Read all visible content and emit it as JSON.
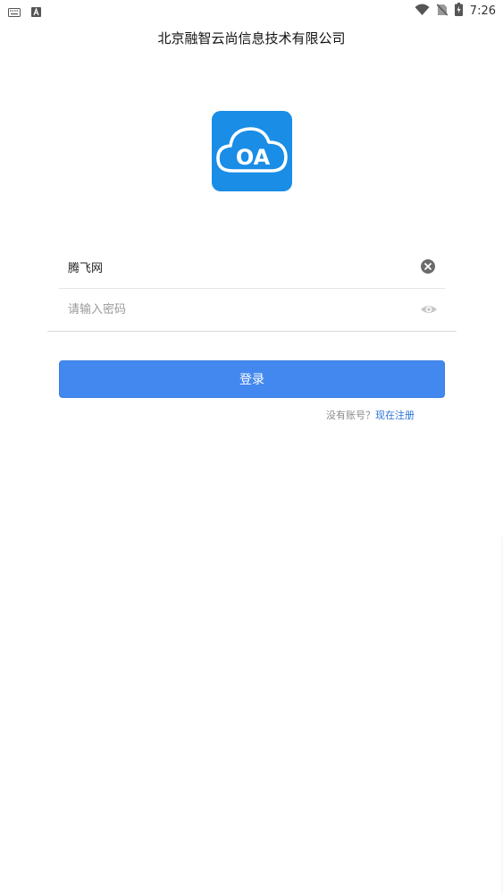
{
  "status_bar": {
    "time": "7:26",
    "left_icons": [
      "keyboard-icon",
      "text-a-icon"
    ],
    "right_icons": [
      "wifi-icon",
      "no-sim-icon",
      "battery-charging-icon"
    ]
  },
  "header": {
    "title": "北京融智云尚信息技术有限公司"
  },
  "logo": {
    "text": "OA",
    "icon": "cloud-icon",
    "color": "#1a8de6"
  },
  "form": {
    "username": {
      "value": "腾飞网",
      "clear_icon": "clear-circle-icon"
    },
    "password": {
      "value": "",
      "placeholder": "请输入密码",
      "toggle_icon": "eye-icon"
    },
    "login_label": "登录",
    "accent_color": "#4388ef"
  },
  "register": {
    "hint": "没有账号？",
    "link_label": "现在注册"
  }
}
